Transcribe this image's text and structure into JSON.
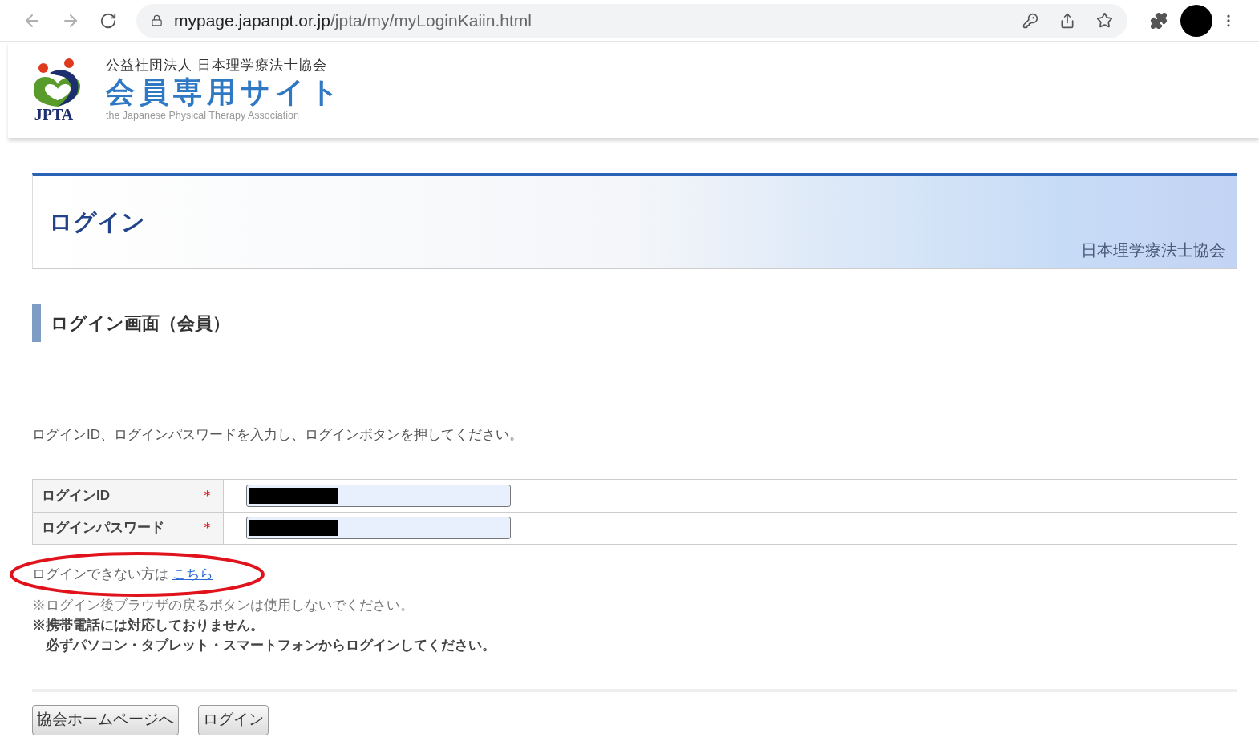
{
  "browser": {
    "url_host": "mypage.japanpt.or.jp",
    "url_path": "/jpta/my/myLoginKaiin.html"
  },
  "header": {
    "logo_text": "JPTA",
    "org": "公益社団法人 日本理学療法士協会",
    "site_title": "会員専用サイト",
    "subtitle": "the Japanese Physical Therapy Association"
  },
  "banner": {
    "title": "ログイン",
    "org": "日本理学療法士協会"
  },
  "section_title": "ログイン画面（会員）",
  "instruction": "ログインID、ログインパスワードを入力し、ログインボタンを押してください。",
  "form": [
    {
      "label": "ログインID",
      "required_mark": "＊"
    },
    {
      "label": "ログインパスワード",
      "required_mark": "＊"
    }
  ],
  "help": {
    "text": "ログインできない方は",
    "link": "こちら"
  },
  "notes": [
    "※ログイン後ブラウザの戻るボタンは使用しないでください。"
  ],
  "warnings": [
    "※携帯電話には対応しておりません。",
    "　必ずパソコン・タブレット・スマートフォンからログインしてください。"
  ],
  "buttons": [
    "協会ホームページへ",
    "ログイン"
  ]
}
